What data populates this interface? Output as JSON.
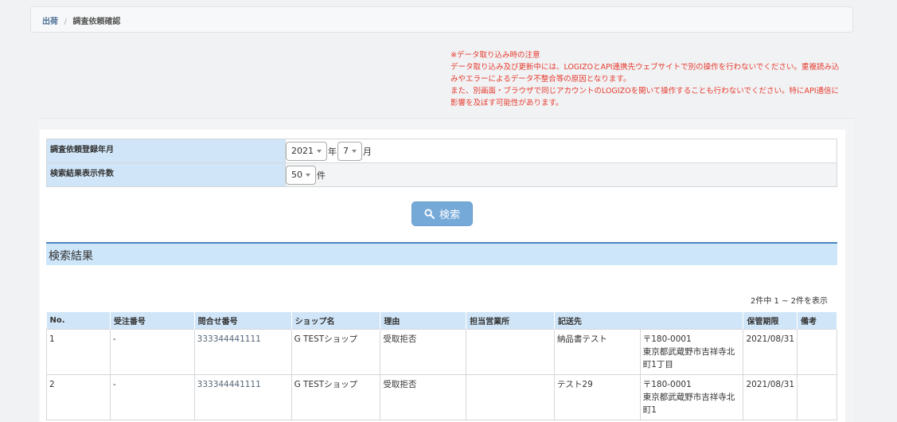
{
  "breadcrumb": {
    "parent": "出荷",
    "separator": "/",
    "current": "調査依頼確認"
  },
  "warning": {
    "lines": [
      "※データ取り込み時の注意",
      "データ取り込み及び更新中には、LOGIZOとAPI連携先ウェブサイトで別の操作を行わないでください。重複読み込みやエラーによるデータ不整合等の原因となります。",
      "また、別画面・ブラウザで同じアカウントのLOGIZOを開いて操作することも行わないでください。特にAPI通信に影響を及ぼす可能性があります。"
    ]
  },
  "form": {
    "date_label": "調査依頼登録年月",
    "year_value": "2021",
    "year_unit": "年",
    "month_value": "7",
    "month_unit": "月",
    "count_label": "検索結果表示件数",
    "count_value": "50",
    "count_unit": "件"
  },
  "search_button": {
    "label": "検索",
    "icon": "search-icon"
  },
  "results": {
    "title": "検索結果",
    "summary": "2件中 1 ~ 2件を表示",
    "columns": [
      "No.",
      "受注番号",
      "問合せ番号",
      "ショップ名",
      "理由",
      "担当営業所",
      "記送先",
      "保管期限",
      "備考"
    ],
    "rows": [
      {
        "no": "1",
        "order": "-",
        "inquiry": "333344441111",
        "shop": "G TESTショップ",
        "reason": "受取拒否",
        "office": "",
        "dest_name": "納品書テスト",
        "dest_addr": "〒180-0001\n東京都武蔵野市吉祥寺北町1丁目",
        "expiry": "2021/08/31",
        "note": ""
      },
      {
        "no": "2",
        "order": "-",
        "inquiry": "333344441111",
        "shop": "G TESTショップ",
        "reason": "受取拒否",
        "office": "",
        "dest_name": "テスト29",
        "dest_addr": "〒180-0001\n東京都武蔵野市吉祥寺北町1",
        "expiry": "2021/08/31",
        "note": ""
      }
    ]
  }
}
